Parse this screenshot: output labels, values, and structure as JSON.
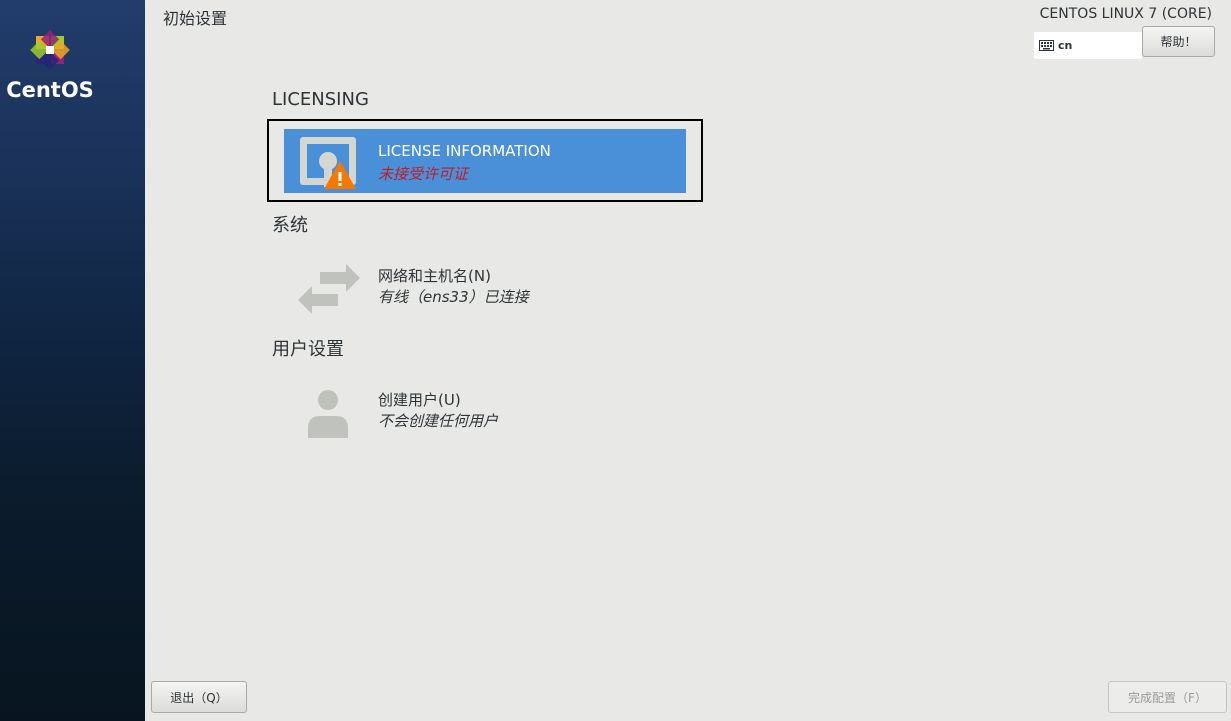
{
  "sidebar": {
    "logo_text": "CentOS",
    "logo_icon": "centos-logo-icon"
  },
  "header": {
    "title": "初始设置",
    "product": "CENTOS LINUX 7 (CORE)",
    "keyboard_layout": "cn",
    "help_label": "帮助！"
  },
  "sections": {
    "licensing": {
      "title": "LICENSING",
      "spoke": {
        "title": "LICENSE INFORMATION",
        "status": "未接受许可证",
        "icon": "license-warning-icon"
      }
    },
    "system": {
      "title": "系统",
      "spoke": {
        "title": "网络和主机名(N)",
        "status": "有线（ens33）已连接",
        "icon": "network-arrows-icon"
      }
    },
    "user": {
      "title": "用户设置",
      "spoke": {
        "title": "创建用户(U)",
        "status": "不会创建任何用户",
        "icon": "user-icon"
      }
    }
  },
  "footer": {
    "quit_label": "退出（Q）",
    "finish_label": "完成配置（F）"
  },
  "colors": {
    "selected": "#4a90d9",
    "warning": "#f57900",
    "status_error": "#c01c28"
  }
}
